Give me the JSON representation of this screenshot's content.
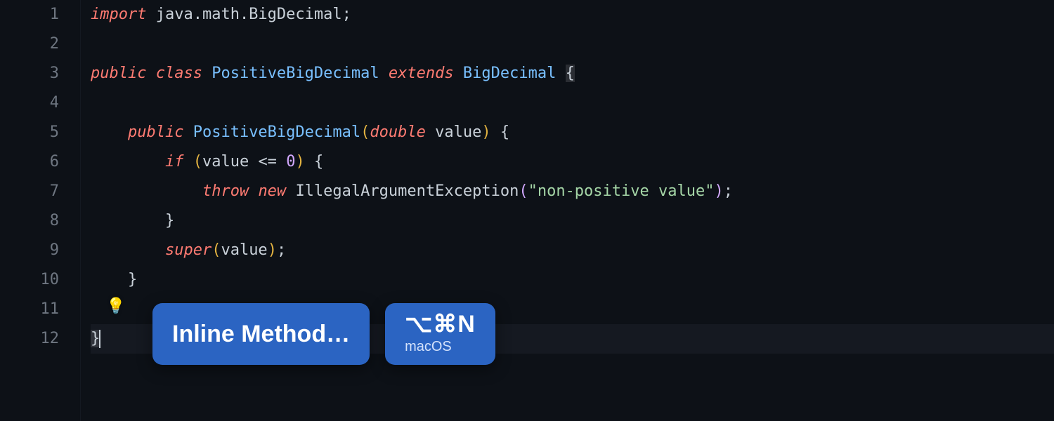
{
  "gutter": [
    "1",
    "2",
    "3",
    "4",
    "5",
    "6",
    "7",
    "8",
    "9",
    "10",
    "11",
    "12"
  ],
  "code": {
    "l1": {
      "kw": "import",
      "pkg": "java.math.BigDecimal",
      "semi": ";"
    },
    "l3": {
      "kw1": "public",
      "kw2": "class",
      "cls": "PositiveBigDecimal",
      "kw3": "extends",
      "sup": "BigDecimal",
      "brace": "{"
    },
    "l5": {
      "kw1": "public",
      "ctor": "PositiveBigDecimal",
      "lp": "(",
      "type": "double",
      "param": "value",
      "rp": ")",
      "brace": "{"
    },
    "l6": {
      "kw": "if",
      "lp": "(",
      "cond": "value <= ",
      "zero": "0",
      "rp": ")",
      "brace": "{"
    },
    "l7": {
      "kw1": "throw",
      "kw2": "new",
      "exc": "IllegalArgumentException",
      "lp": "(",
      "str": "\"non-positive value\"",
      "rp": ")",
      "semi": ";"
    },
    "l8": {
      "brace": "}"
    },
    "l9": {
      "sup": "super",
      "lp": "(",
      "arg": "value",
      "rp": ")",
      "semi": ";"
    },
    "l10": {
      "brace": "}"
    },
    "l12": {
      "brace": "}"
    }
  },
  "lightbulb": "💡",
  "popup": {
    "action_label": "Inline Method…",
    "shortcut_keys": "⌥⌘N",
    "shortcut_os": "macOS"
  }
}
